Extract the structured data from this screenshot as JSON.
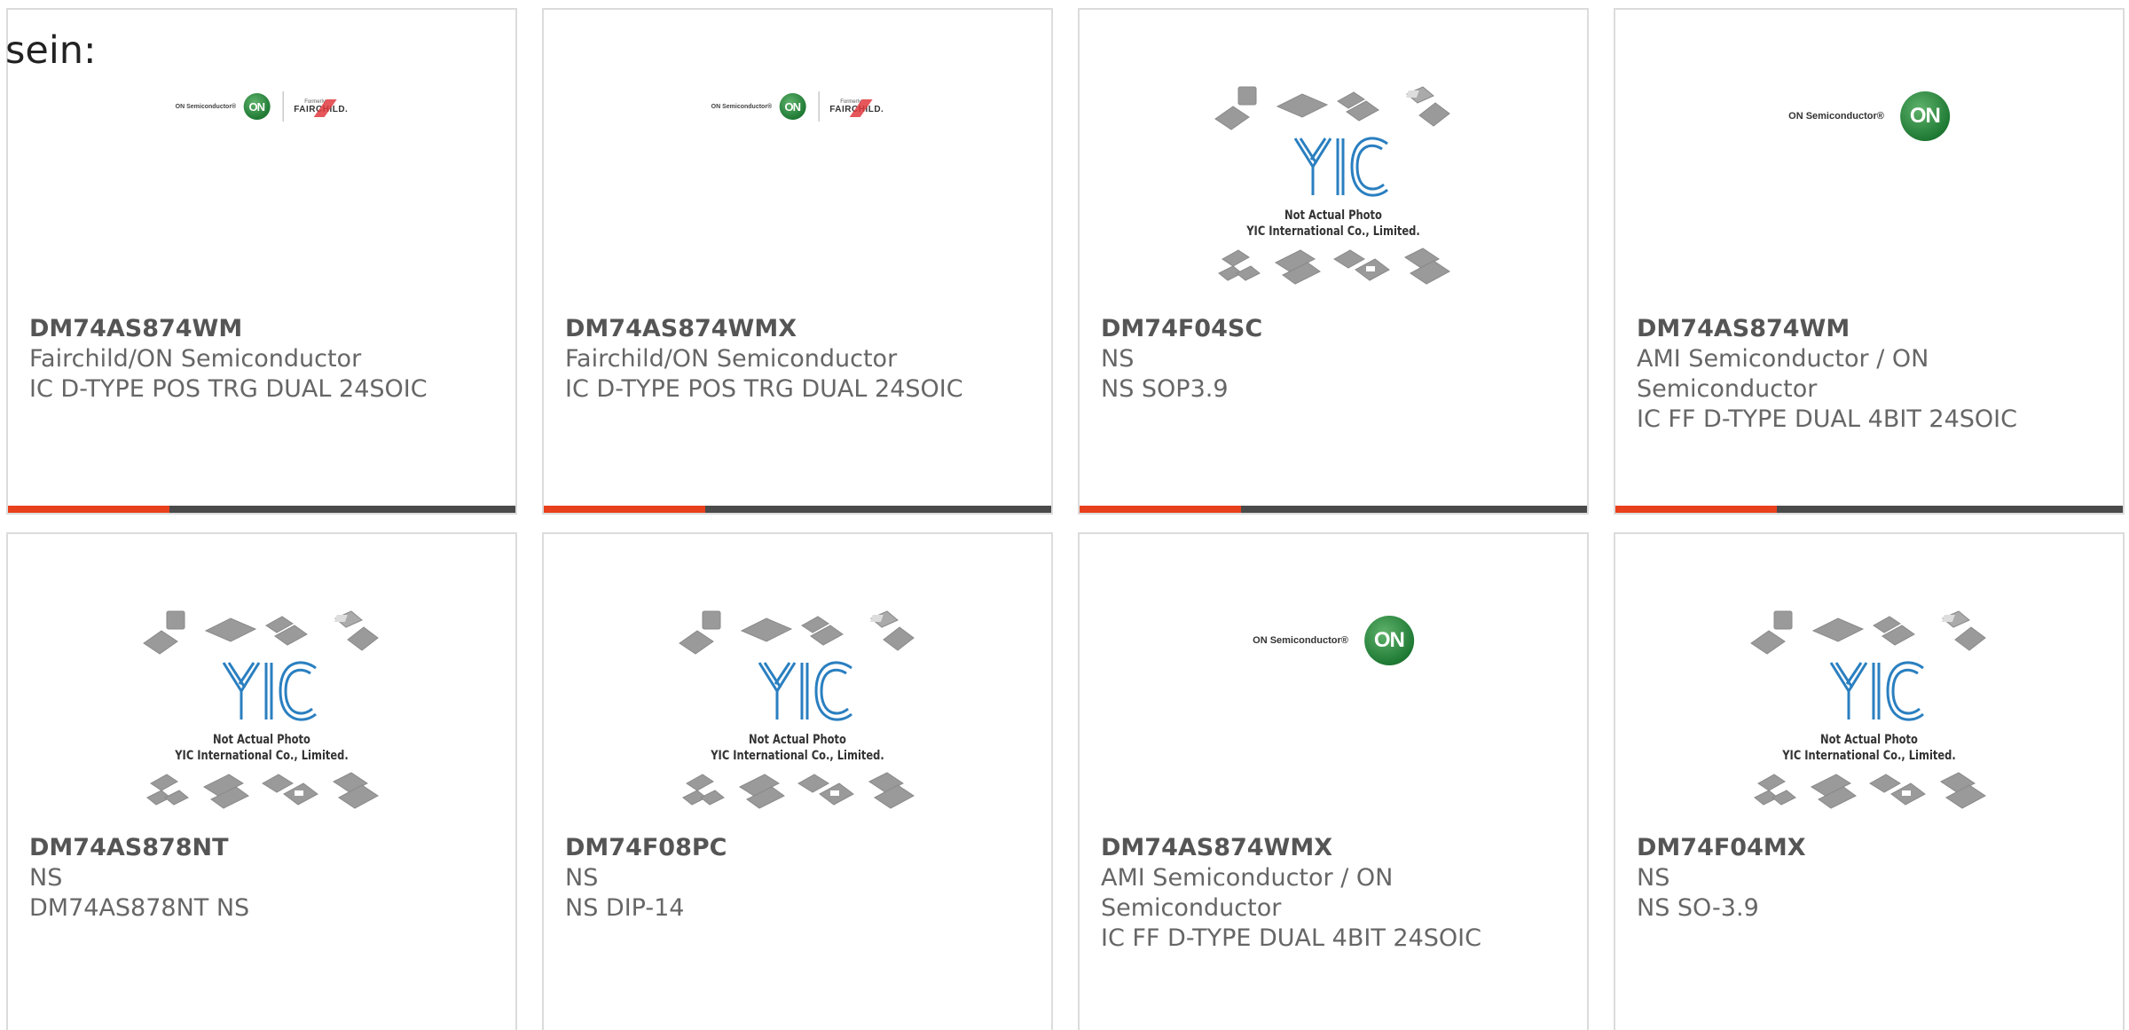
{
  "intro_text": "sein:",
  "colors": {
    "accent": "#e8401c",
    "bar": "#4a4a4a",
    "on_green": "#1f7a34",
    "fairchild_red": "#e03a3e",
    "yic_blue": "#2a7fc0"
  },
  "logo_text": {
    "on_semi": "ON Semiconductor®",
    "on": "ON",
    "formerly": "Formerly",
    "fairchild": "FAIRCHILD.",
    "yic_line1": "Not Actual Photo",
    "yic_line2": "YIC International Co., Limited."
  },
  "cards": [
    {
      "part_number": "DM74AS874WM",
      "manufacturer": "Fairchild/ON Semiconductor",
      "description": "IC D-TYPE POS TRG DUAL 24SOIC",
      "image": "on-fairchild-logo"
    },
    {
      "part_number": "DM74AS874WMX",
      "manufacturer": "Fairchild/ON Semiconductor",
      "description": "IC D-TYPE POS TRG DUAL 24SOIC",
      "image": "on-fairchild-logo"
    },
    {
      "part_number": "DM74F04SC",
      "manufacturer": "NS",
      "description": "NS SOP3.9",
      "image": "yic-not-actual-photo"
    },
    {
      "part_number": "DM74AS874WM",
      "manufacturer": "AMI Semiconductor / ON Semiconductor",
      "description": "IC FF D-TYPE DUAL 4BIT 24SOIC",
      "image": "on-semiconductor-logo"
    },
    {
      "part_number": "DM74AS878NT",
      "manufacturer": "NS",
      "description": "DM74AS878NT NS",
      "image": "yic-not-actual-photo"
    },
    {
      "part_number": "DM74F08PC",
      "manufacturer": "NS",
      "description": "NS DIP-14",
      "image": "yic-not-actual-photo"
    },
    {
      "part_number": "DM74AS874WMX",
      "manufacturer": "AMI Semiconductor / ON Semiconductor",
      "description": "IC FF D-TYPE DUAL 4BIT 24SOIC",
      "image": "on-semiconductor-logo"
    },
    {
      "part_number": "DM74F04MX",
      "manufacturer": "NS",
      "description": "NS SO-3.9",
      "image": "yic-not-actual-photo"
    }
  ]
}
